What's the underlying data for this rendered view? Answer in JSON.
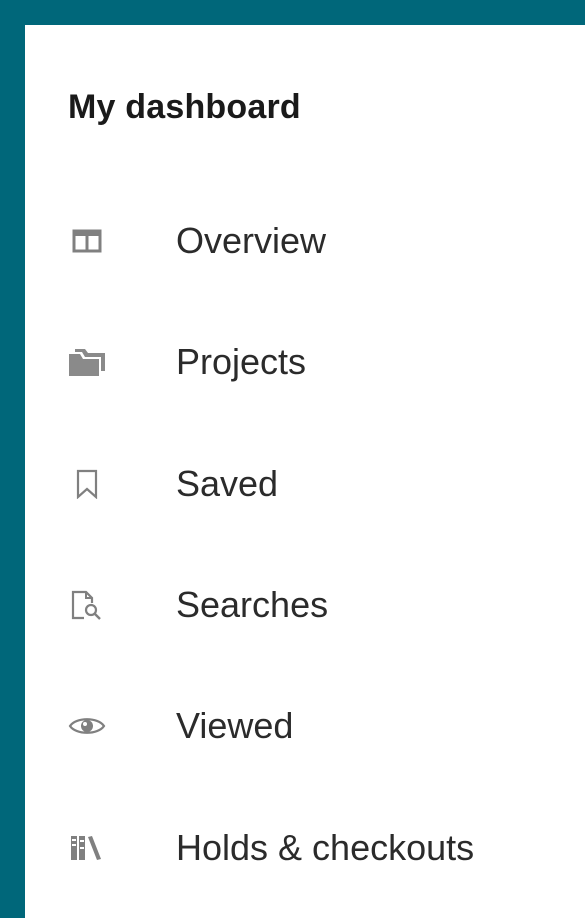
{
  "dashboard": {
    "title": "My dashboard",
    "items": [
      {
        "label": "Overview",
        "icon": "overview-icon"
      },
      {
        "label": "Projects",
        "icon": "folder-icon"
      },
      {
        "label": "Saved",
        "icon": "bookmark-icon"
      },
      {
        "label": "Searches",
        "icon": "search-document-icon"
      },
      {
        "label": "Viewed",
        "icon": "eye-icon"
      },
      {
        "label": "Holds & checkouts",
        "icon": "books-icon"
      }
    ]
  },
  "colors": {
    "frame": "#00677a",
    "panel": "#ffffff",
    "text": "#2b2b2b",
    "icon": "#808080"
  }
}
